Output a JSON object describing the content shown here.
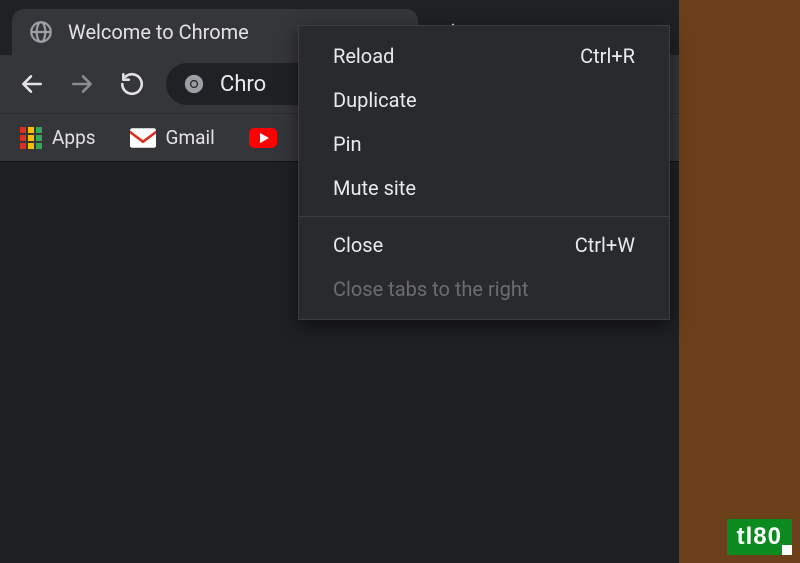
{
  "tab": {
    "title": "Welcome to Chrome"
  },
  "omnibox": {
    "text": "Chro"
  },
  "bookmarks": {
    "apps": "Apps",
    "gmail": "Gmail"
  },
  "context_menu": {
    "reload": {
      "label": "Reload",
      "shortcut": "Ctrl+R"
    },
    "duplicate": {
      "label": "Duplicate"
    },
    "pin": {
      "label": "Pin"
    },
    "mute": {
      "label": "Mute site"
    },
    "close": {
      "label": "Close",
      "shortcut": "Ctrl+W"
    },
    "close_right": {
      "label": "Close tabs to the right"
    }
  },
  "watermark": "tl80"
}
